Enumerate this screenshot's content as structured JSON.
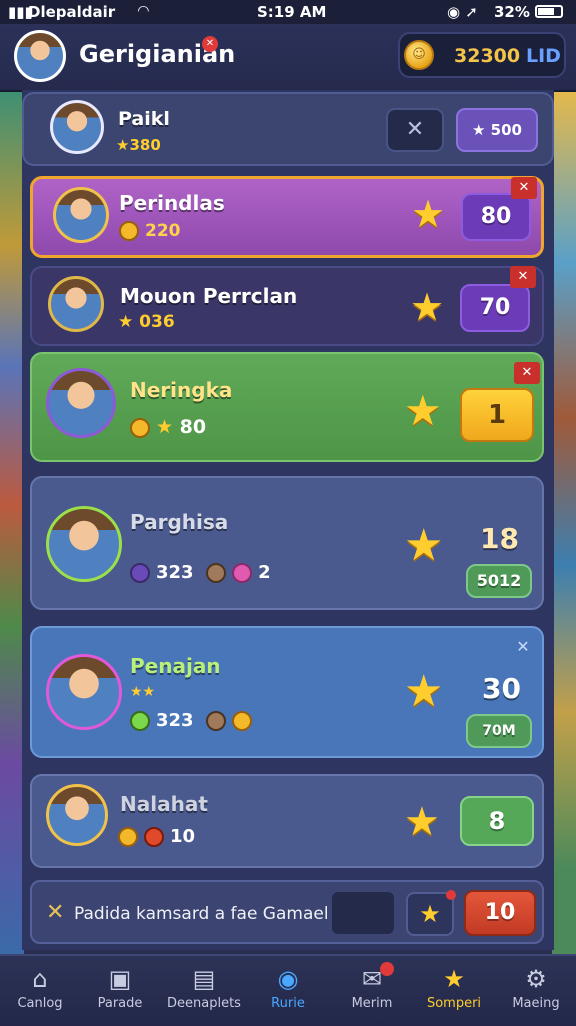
{
  "status": {
    "signal": "▮▮▮",
    "carrier": "Dlepaldair",
    "time": "S:19 AM",
    "battery": "32%"
  },
  "player": {
    "name": "Gerigianian",
    "currency_amount": "32300",
    "currency_unit": "LID"
  },
  "cards": [
    {
      "name": "Paikl",
      "stat": "★380",
      "badge": "★ 500"
    },
    {
      "name": "Perindlas",
      "stat": "220",
      "score": "80",
      "flag": "✕"
    },
    {
      "name": "Mouon Perrclan",
      "stat": "★ 036",
      "score": "70",
      "flag": "✕"
    },
    {
      "name": "Neringka",
      "stat": "80",
      "score": "1",
      "flag": "✕"
    },
    {
      "name": "Parghisa",
      "stat1": "323",
      "stat2": "2",
      "big": "18",
      "score": "5012"
    },
    {
      "name": "Penajan",
      "stars": "★★",
      "stat": "323",
      "big": "30",
      "score": "70M",
      "flag": "✕"
    },
    {
      "name": "Nalahat",
      "stat": "10",
      "score": "8"
    }
  ],
  "banner": {
    "text": "Padida kamsard a fae Gamael.",
    "button": "10"
  },
  "nav": [
    {
      "label": "Canlog",
      "icon": "home-icon"
    },
    {
      "label": "Parade",
      "icon": "bag-icon"
    },
    {
      "label": "Deenaplets",
      "icon": "cards-icon"
    },
    {
      "label": "Rurie",
      "icon": "circle-icon"
    },
    {
      "label": "Merim",
      "icon": "mail-icon"
    },
    {
      "label": "Somperi",
      "icon": "star-icon"
    },
    {
      "label": "Maeing",
      "icon": "gear-icon"
    }
  ],
  "colors": {
    "accent_gold": "#ffcd2e",
    "accent_blue": "#4aa8ff",
    "card_purple": "#9e52bb",
    "card_green": "#58a050",
    "card_blue": "#4876b8"
  }
}
